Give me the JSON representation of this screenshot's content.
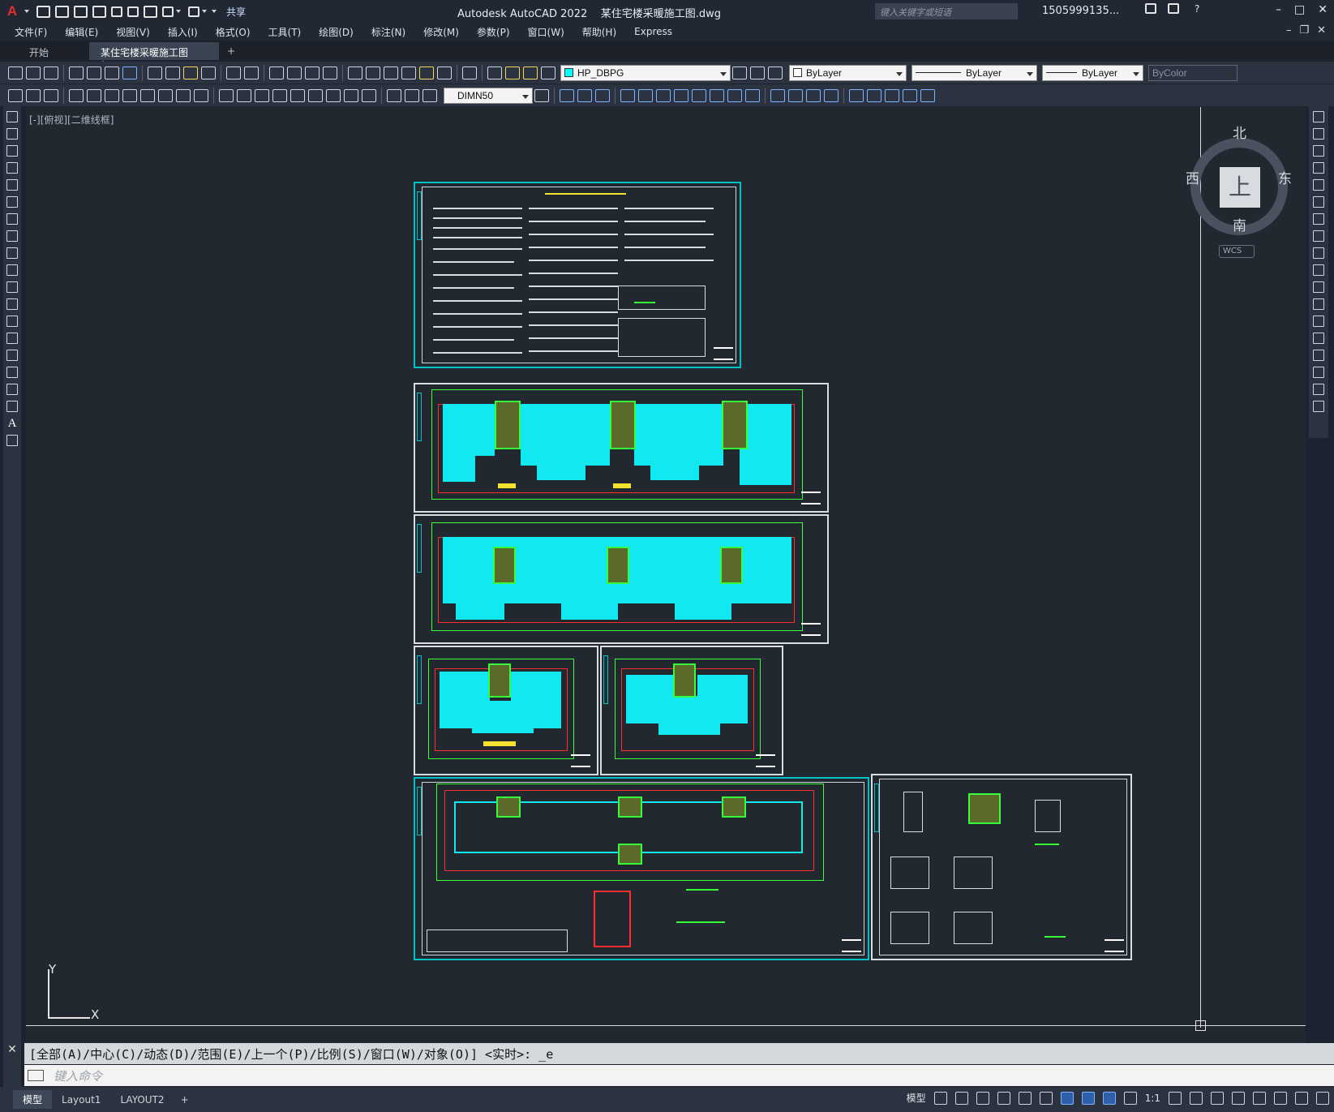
{
  "titlebar": {
    "logo": "A",
    "share_label": "共享",
    "app_title": "Autodesk AutoCAD 2022    某住宅楼采暖施工图.dwg",
    "search_placeholder": "键入关键字或短语",
    "user": "1505999135...",
    "help": "?"
  },
  "menu": {
    "items": [
      "文件(F)",
      "编辑(E)",
      "视图(V)",
      "插入(I)",
      "格式(O)",
      "工具(T)",
      "绘图(D)",
      "标注(N)",
      "修改(M)",
      "参数(P)",
      "窗口(W)",
      "帮助(H)",
      "Express"
    ]
  },
  "tabs": {
    "start": "开始",
    "active": "某住宅楼采暖施工图*",
    "close": "×",
    "plus": "+"
  },
  "toolbar1": {
    "layer": "HP_DBPG",
    "color": "ByLayer",
    "linetype": "ByLayer",
    "lineweight": "ByLayer",
    "plotstyle": "ByColor",
    "layer_swatch_color": "#00ffff"
  },
  "toolbar2": {
    "dimstyle": "DIMN50"
  },
  "viewport": {
    "label": "[-][俯视][二维线框]"
  },
  "viewcube": {
    "top": "上",
    "north": "北",
    "south": "南",
    "east": "东",
    "west": "西",
    "wcs": "WCS"
  },
  "ucs": {
    "x": "X",
    "y": "Y"
  },
  "command": {
    "history": "[全部(A)/中心(C)/动态(D)/范围(E)/上一个(P)/比例(S)/窗口(W)/对象(O)] <实时>: _e",
    "placeholder": "键入命令"
  },
  "status": {
    "layouts": [
      "模型",
      "Layout1",
      "LAYOUT2"
    ],
    "plus": "+",
    "model_label": "模型",
    "scale": "1:1"
  },
  "colors": {
    "accent": "#00c0c8",
    "fill": "#12e8f0",
    "grid_red": "#ff2d2d",
    "grid_green": "#39ff39"
  }
}
